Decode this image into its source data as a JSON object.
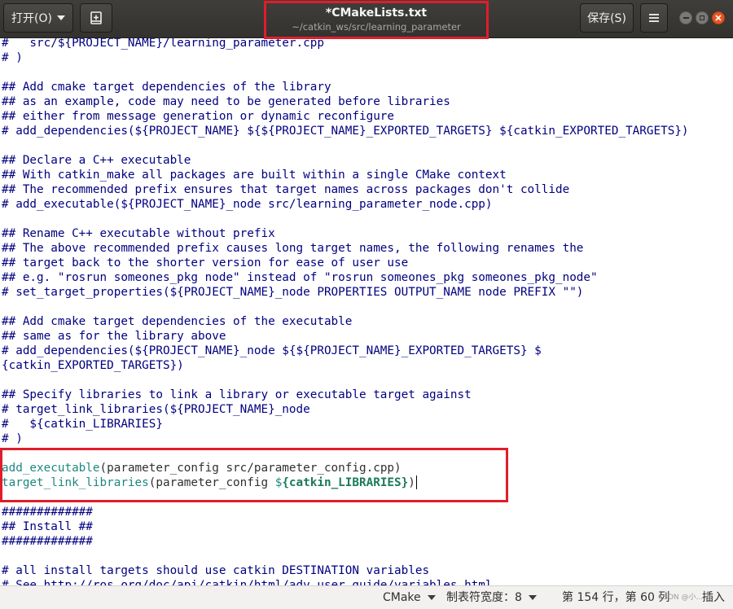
{
  "header": {
    "open_label": "打开(O)",
    "title": "*CMakeLists.txt",
    "subtitle": "~/catkin_ws/src/learning_parameter",
    "save_label": "保存(S)"
  },
  "editor": {
    "lines": [
      "#   src/${PROJECT_NAME}/learning_parameter.cpp",
      "# )",
      "",
      "## Add cmake target dependencies of the library",
      "## as an example, code may need to be generated before libraries",
      "## either from message generation or dynamic reconfigure",
      "# add_dependencies(${PROJECT_NAME} ${${PROJECT_NAME}_EXPORTED_TARGETS} ${catkin_EXPORTED_TARGETS})",
      "",
      "## Declare a C++ executable",
      "## With catkin_make all packages are built within a single CMake context",
      "## The recommended prefix ensures that target names across packages don't collide",
      "# add_executable(${PROJECT_NAME}_node src/learning_parameter_node.cpp)",
      "",
      "## Rename C++ executable without prefix",
      "## The above recommended prefix causes long target names, the following renames the",
      "## target back to the shorter version for ease of user use",
      "## e.g. \"rosrun someones_pkg node\" instead of \"rosrun someones_pkg someones_pkg_node\"",
      "# set_target_properties(${PROJECT_NAME}_node PROPERTIES OUTPUT_NAME node PREFIX \"\")",
      "",
      "## Add cmake target dependencies of the executable",
      "## same as for the library above",
      "# add_dependencies(${PROJECT_NAME}_node ${${PROJECT_NAME}_EXPORTED_TARGETS} $",
      "{catkin_EXPORTED_TARGETS})",
      "",
      "## Specify libraries to link a library or executable target against",
      "# target_link_libraries(${PROJECT_NAME}_node",
      "#   ${catkin_LIBRARIES}",
      "# )",
      "",
      "",
      "",
      "#############",
      "## Install ##",
      "#############",
      "",
      "",
      "# all install targets should use catkin DESTINATION variables",
      "# See http://ros.org/doc/api/catkin/html/adv_user_guide/variables.html"
    ],
    "code1": {
      "cmd": "add_executable",
      "args": "(parameter_config src/parameter_config.cpp)"
    },
    "code2": {
      "cmd": "target_link_libraries",
      "pre": "(parameter_config ",
      "dollar": "$",
      "var": "{catkin_LIBRARIES}",
      "post": ")"
    }
  },
  "status": {
    "language": "CMake",
    "tab_width": "制表符宽度：8",
    "position": "第 154 行，第 60 列",
    "mode": "插入",
    "watermark": "CSDN @小..."
  },
  "colors": {
    "comment": "#000080",
    "keyword": "#1e8880",
    "highlight_box": "#e01d2b",
    "header_bg": "#3a3935",
    "close_button": "#e95420"
  }
}
